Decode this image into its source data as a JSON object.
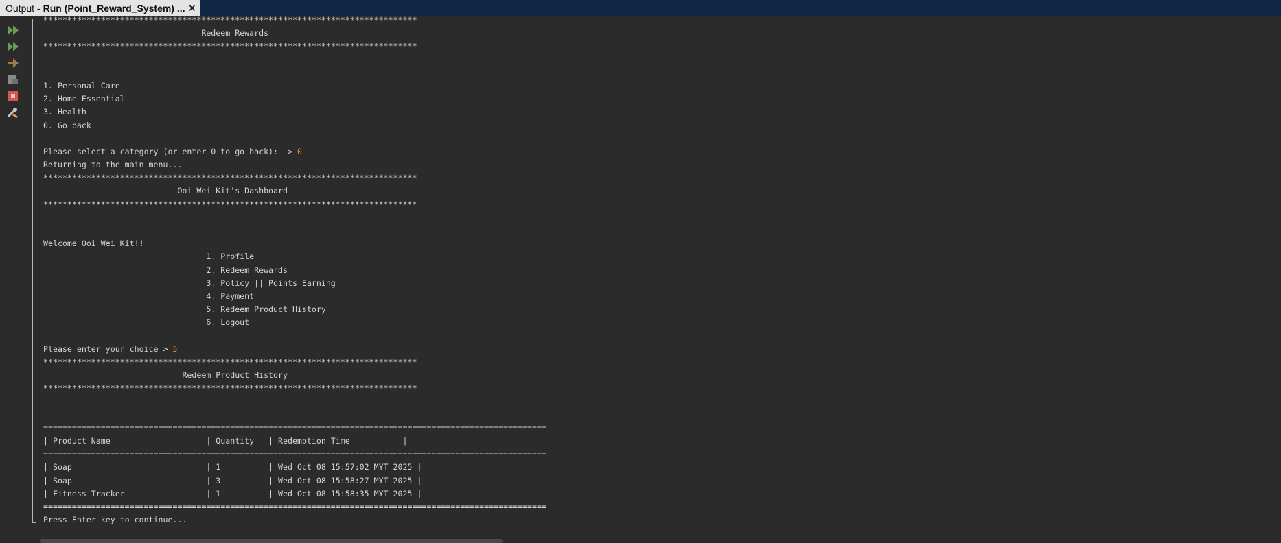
{
  "window": {
    "tab_prefix": "Output - ",
    "tab_title": "Run (Point_Reward_System) ...",
    "close_glyph": "✕"
  },
  "toolbar": {
    "buttons": [
      {
        "name": "rerun-icon",
        "color": "#6a9b52"
      },
      {
        "name": "rerun-with-args-icon",
        "color": "#6a9b52"
      },
      {
        "name": "step-icon",
        "color": "#a07a45"
      },
      {
        "name": "output-settings-icon",
        "color": "#8a8a8a"
      },
      {
        "name": "stop-icon",
        "color": "#d9534f"
      },
      {
        "name": "tools-icon",
        "color": "#c9c9c9"
      }
    ]
  },
  "colors": {
    "background": "#2b2b2b",
    "text": "#d4d4d4",
    "user_input": "#d78f40",
    "title_bar": "#0f2742"
  },
  "console": {
    "lines": [
      {
        "text": "******************************************************************************"
      },
      {
        "text": "                                 Redeem Rewards"
      },
      {
        "text": "******************************************************************************"
      },
      {
        "text": ""
      },
      {
        "text": ""
      },
      {
        "text": "1. Personal Care"
      },
      {
        "text": "2. Home Essential"
      },
      {
        "text": "3. Health"
      },
      {
        "text": "0. Go back"
      },
      {
        "text": ""
      },
      {
        "text": "Please select a category (or enter 0 to go back):  > ",
        "input": "0"
      },
      {
        "text": "Returning to the main menu..."
      },
      {
        "text": "******************************************************************************"
      },
      {
        "text": "                            Ooi Wei Kit's Dashboard"
      },
      {
        "text": "******************************************************************************"
      },
      {
        "text": ""
      },
      {
        "text": ""
      },
      {
        "text": "Welcome Ooi Wei Kit!!"
      },
      {
        "text": "                                  1. Profile"
      },
      {
        "text": "                                  2. Redeem Rewards"
      },
      {
        "text": "                                  3. Policy || Points Earning"
      },
      {
        "text": "                                  4. Payment"
      },
      {
        "text": "                                  5. Redeem Product History"
      },
      {
        "text": "                                  6. Logout"
      },
      {
        "text": ""
      },
      {
        "text": "Please enter your choice > ",
        "input": "5"
      },
      {
        "text": "******************************************************************************"
      },
      {
        "text": "                             Redeem Product History"
      },
      {
        "text": "******************************************************************************"
      },
      {
        "text": ""
      },
      {
        "text": ""
      },
      {
        "text": "========================================================================================================="
      },
      {
        "text": "| Product Name                    | Quantity   | Redemption Time           |"
      },
      {
        "text": "========================================================================================================="
      },
      {
        "text": "| Soap                            | 1          | Wed Oct 08 15:57:02 MYT 2025 |"
      },
      {
        "text": "| Soap                            | 3          | Wed Oct 08 15:58:27 MYT 2025 |"
      },
      {
        "text": "| Fitness Tracker                 | 1          | Wed Oct 08 15:58:35 MYT 2025 |"
      },
      {
        "text": "========================================================================================================="
      },
      {
        "text": "Press Enter key to continue..."
      }
    ]
  }
}
